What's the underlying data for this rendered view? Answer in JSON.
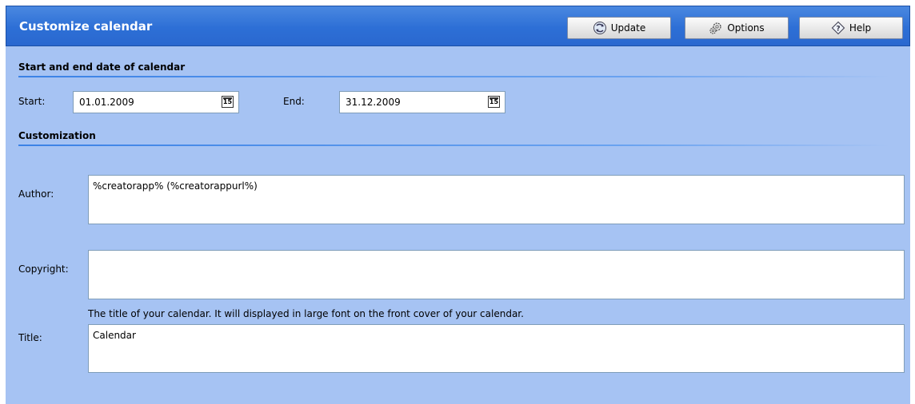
{
  "window": {
    "title": "Customize calendar"
  },
  "toolbar": {
    "update_label": "Update",
    "options_label": "Options",
    "help_label": "Help"
  },
  "dates_section": {
    "heading": "Start and end date of calendar",
    "start_label": "Start:",
    "start_value": "01.01.2009",
    "end_label": "End:",
    "end_value": "31.12.2009",
    "calendar_icon_text": "15"
  },
  "customization": {
    "heading": "Customization",
    "author_label": "Author:",
    "author_value": "%creatorapp% (%creatorappurl%)",
    "copyright_label": "Copyright:",
    "copyright_value": "",
    "title_hint": "The title of your calendar. It will displayed in large font on the front cover of your calendar.",
    "title_label": "Title:",
    "title_value": "Calendar"
  },
  "colors": {
    "panel_background": "#a6c3f3",
    "titlebar_blue": "#2d6fd6",
    "section_rule": "#3b82e6"
  },
  "icons": {
    "update": "update-arrows-icon",
    "options": "options-gears-icon",
    "help": "help-question-icon",
    "calendar": "calendar-icon"
  }
}
